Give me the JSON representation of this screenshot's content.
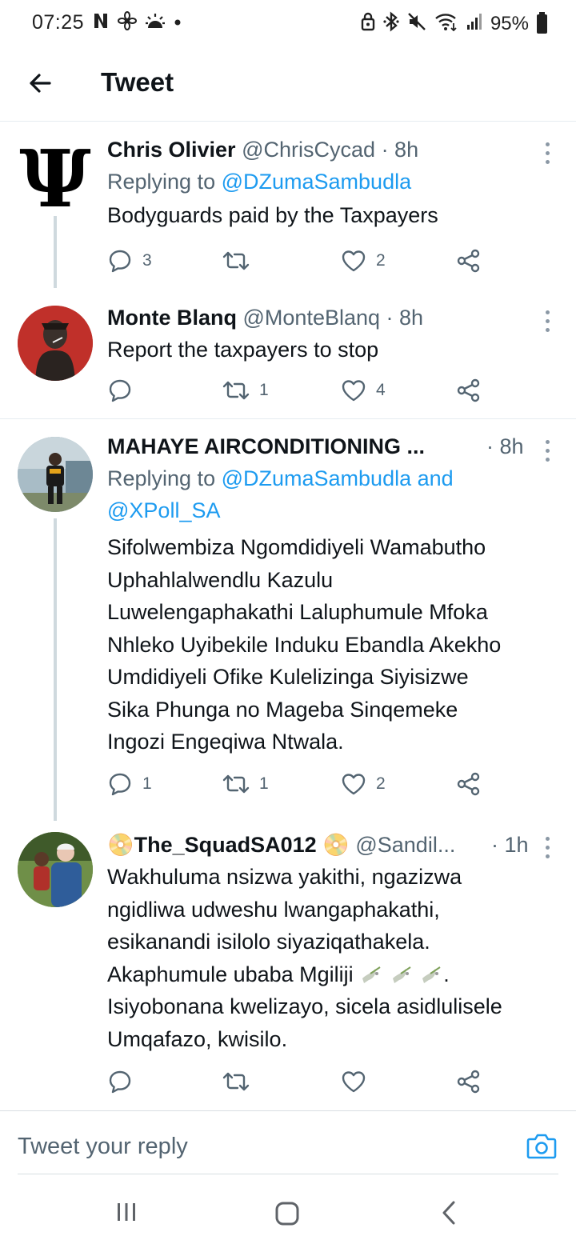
{
  "status_bar": {
    "time": "07:25",
    "battery_percent": "95%",
    "left_icons": [
      "netflix-n-icon",
      "fan-icon",
      "weather-icon",
      "dot-icon"
    ],
    "right_icons": [
      "lock-icon",
      "bluetooth-icon",
      "mute-icon",
      "wifi-icon",
      "signal-icon"
    ]
  },
  "header": {
    "title": "Tweet",
    "back_icon": "arrow-left-icon"
  },
  "tweets": [
    {
      "name": "Chris Olivier",
      "handle": "@ChrisCycad",
      "time": "· 8h",
      "reply_label": "Replying to ",
      "reply_to": "@DZumaSambudla",
      "text": "Bodyguards paid by the Taxpayers",
      "replies": "3",
      "retweets": "",
      "likes": "2"
    },
    {
      "name": "Monte Blanq",
      "handle": "@MonteBlanq",
      "time": "· 8h",
      "text": "Report the taxpayers to stop",
      "replies": "",
      "retweets": "1",
      "likes": "4"
    },
    {
      "name": "MAHAYE AIRCONDITIONING ...",
      "handle": "",
      "time": "· 8h",
      "reply_label": "Replying to ",
      "reply_to": "@DZumaSambudla and",
      "reply_to_2": "@XPoll_SA",
      "text_lines": [
        "Sifolwembiza Ngomdidiyeli Wamabutho",
        "Uphahlalwendlu Kazulu",
        "Luwelengaphakathi Laluphumule Mfoka",
        "Nhleko Uyibekile Induku Ebandla Akekho",
        "Umdidiyeli Ofike Kulelizinga Siyisizwe",
        "Sika Phunga no Mageba Sinqemeke",
        "Ingozi Engeqiwa Ntwala."
      ],
      "replies": "1",
      "retweets": "1",
      "likes": "2"
    },
    {
      "name": "The_SquadSA012",
      "handle": "@Sandil...",
      "time": "· 1h",
      "name_emoji": "📀",
      "text_lines": [
        "Wakhuluma nsizwa yakithi, ngazizwa",
        "ngidliwa udweshu lwangaphakathi,",
        "esikanandi isilolo siyaziqathakela.",
        "Akaphumule ubaba Mgiliji",
        "Isiyobonana kwelizayo, sicela asidlulisele",
        "Umqafazo, kwisilo."
      ],
      "line4_suffix": ".",
      "replies": "",
      "retweets": "",
      "likes": ""
    }
  ],
  "reply_bar": {
    "placeholder": "Tweet your reply",
    "camera_icon": "camera-icon"
  },
  "nav_bar": {
    "icons": [
      "recent-apps-icon",
      "home-icon",
      "back-icon"
    ]
  },
  "colors": {
    "accent": "#1d9bf0",
    "text": "#0f1419",
    "secondary": "#536471",
    "line": "#cfd9de"
  }
}
